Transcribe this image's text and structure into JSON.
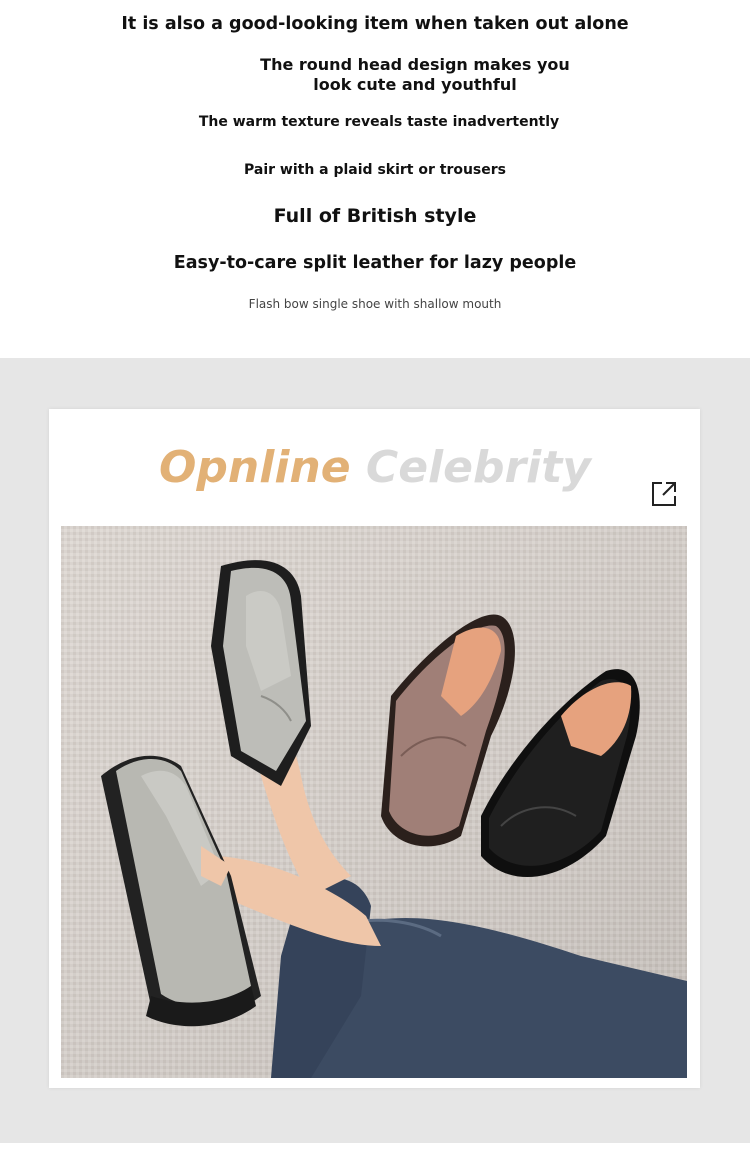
{
  "intro": {
    "line1": "It is also a good-looking item when taken out alone",
    "line2": "The round head design makes you look cute and youthful",
    "line3": "The warm texture reveals taste inadvertently",
    "line4": "Pair with a plaid skirt or trousers",
    "line5": "Full of British style",
    "line6": "Easy-to-care split leather for lazy people",
    "line7": "Flash bow single shoe with shallow mouth"
  },
  "card": {
    "title_part1": "Opnline",
    "title_part2": "Celebrity",
    "icon": "expand-icon",
    "accent_color": "#e2b176",
    "title_grey": "#d9d9d9"
  },
  "photo": {
    "subject": "shoes",
    "colors": {
      "grey_leather": "#bdbdb8",
      "brown_leather": "#a07f77",
      "black_leather": "#1b1b1b",
      "lining": "#e6a27e",
      "jeans": "#3c4b62",
      "skin": "#efc6a9"
    }
  }
}
